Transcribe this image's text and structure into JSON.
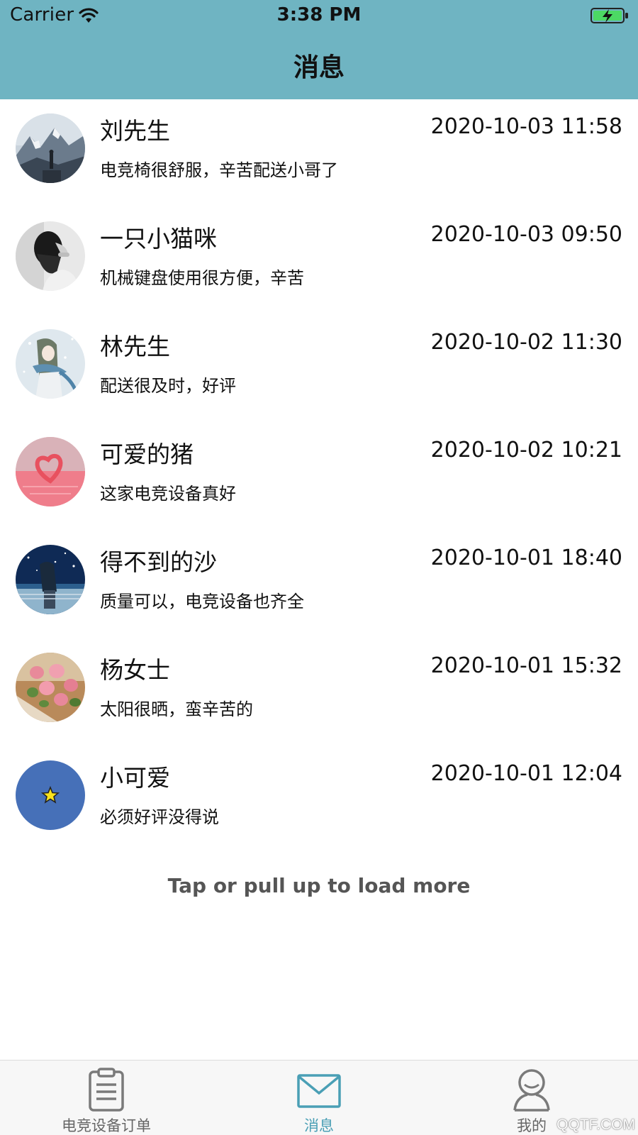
{
  "status": {
    "carrier": "Carrier",
    "time": "3:38 PM"
  },
  "header": {
    "title": "消息",
    "color": "#6fb4c2"
  },
  "messages": [
    {
      "name": "刘先生",
      "time": "2020-10-03 11:58",
      "preview": "电竞椅很舒服，辛苦配送小哥了",
      "avatar": "mountain-avatar"
    },
    {
      "name": "一只小猫咪",
      "time": "2020-10-03 09:50",
      "preview": "机械键盘使用很方便，辛苦",
      "avatar": "bw-portrait-avatar"
    },
    {
      "name": "林先生",
      "time": "2020-10-02 11:30",
      "preview": "配送很及时，好评",
      "avatar": "winter-anime-avatar"
    },
    {
      "name": "可爱的猪",
      "time": "2020-10-02 10:21",
      "preview": "这家电竞设备真好",
      "avatar": "pink-heart-avatar"
    },
    {
      "name": "得不到的沙",
      "time": "2020-10-01 18:40",
      "preview": "质量可以，电竞设备也齐全",
      "avatar": "night-sky-avatar"
    },
    {
      "name": "杨女士",
      "time": "2020-10-01 15:32",
      "preview": "太阳很晒，蛮辛苦的",
      "avatar": "roses-avatar"
    },
    {
      "name": "小可爱",
      "time": "2020-10-01 12:04",
      "preview": "必须好评没得说",
      "avatar": "star-avatar"
    }
  ],
  "load_more": "Tap or pull up to load more",
  "tabs": [
    {
      "label": "电竞设备订单",
      "icon": "clipboard-icon"
    },
    {
      "label": "消息",
      "icon": "envelope-icon",
      "active": true
    },
    {
      "label": "我的",
      "icon": "person-icon"
    }
  ],
  "watermark": "QQTF.COM"
}
